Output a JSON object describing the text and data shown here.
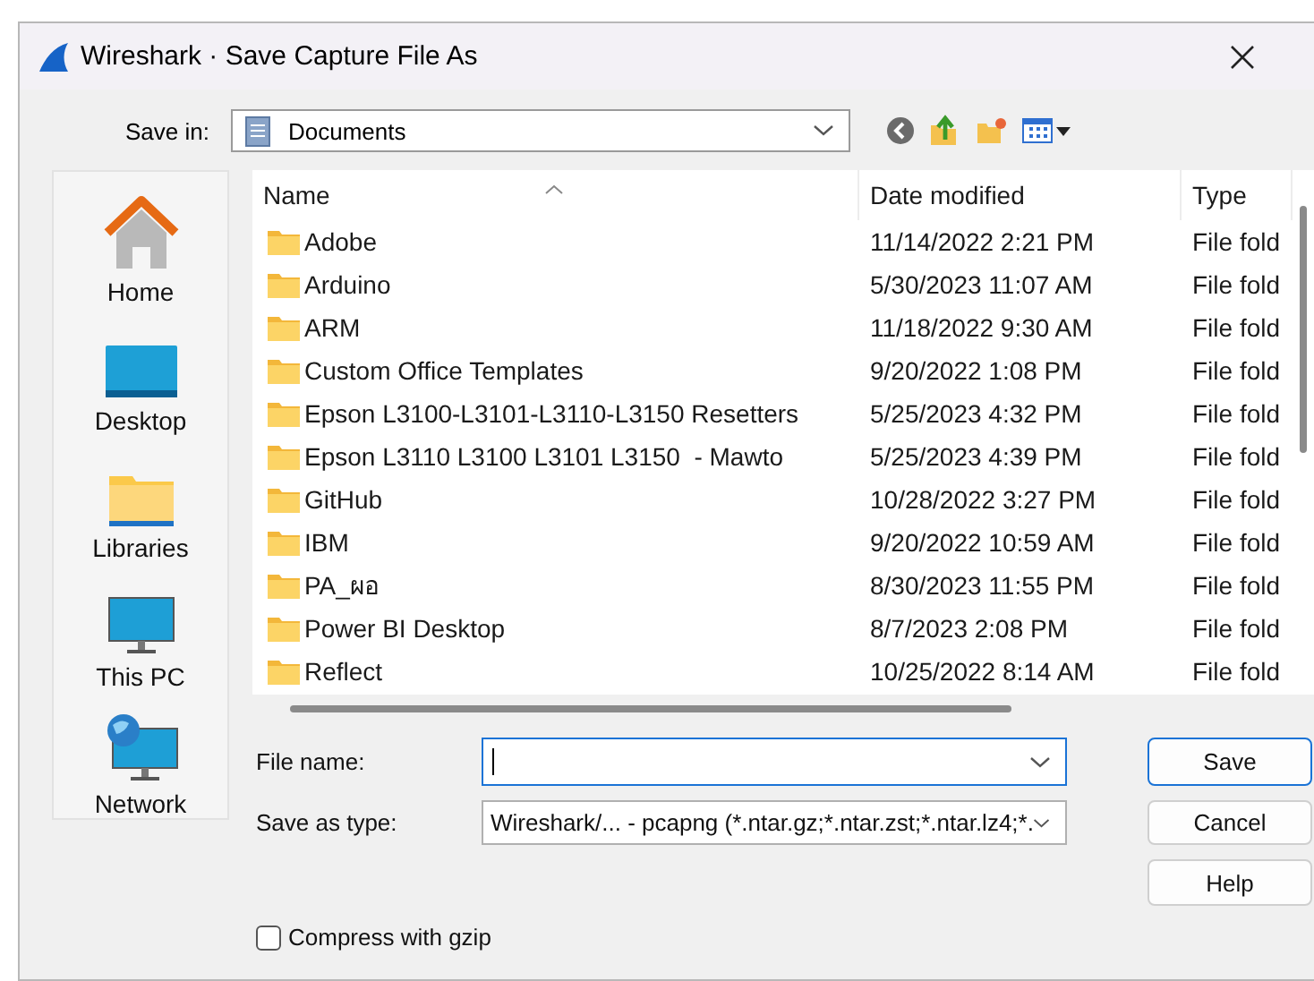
{
  "window": {
    "title": "Wireshark · Save Capture File As"
  },
  "save_in": {
    "label": "Save in:",
    "value": "Documents"
  },
  "places": [
    {
      "label": "Home",
      "kind": "home"
    },
    {
      "label": "Desktop",
      "kind": "desktop"
    },
    {
      "label": "Libraries",
      "kind": "libraries"
    },
    {
      "label": "This PC",
      "kind": "pc"
    },
    {
      "label": "Network",
      "kind": "network"
    }
  ],
  "file_list": {
    "columns": [
      "Name",
      "Date modified",
      "Type"
    ],
    "rows": [
      {
        "name": "Adobe",
        "date": "11/14/2022 2:21 PM",
        "type": "File fold"
      },
      {
        "name": "Arduino",
        "date": "5/30/2023 11:07 AM",
        "type": "File fold"
      },
      {
        "name": "ARM",
        "date": "11/18/2022 9:30 AM",
        "type": "File fold"
      },
      {
        "name": "Custom Office Templates",
        "date": "9/20/2022 1:08 PM",
        "type": "File fold"
      },
      {
        "name": "Epson L3100-L3101-L3110-L3150 Resetters",
        "date": "5/25/2023 4:32 PM",
        "type": "File fold"
      },
      {
        "name": "Epson L3110 L3100 L3101 L3150  - Mawto",
        "date": "5/25/2023 4:39 PM",
        "type": "File fold"
      },
      {
        "name": "GitHub",
        "date": "10/28/2022 3:27 PM",
        "type": "File fold"
      },
      {
        "name": "IBM",
        "date": "9/20/2022 10:59 AM",
        "type": "File fold"
      },
      {
        "name": "PA_ผอ",
        "date": "8/30/2023 11:55 PM",
        "type": "File fold"
      },
      {
        "name": "Power BI Desktop",
        "date": "8/7/2023 2:08 PM",
        "type": "File fold"
      },
      {
        "name": "Reflect",
        "date": "10/25/2022 8:14 AM",
        "type": "File fold"
      }
    ]
  },
  "file_name": {
    "label": "File name:",
    "focused": true
  },
  "save_as_type": {
    "label": "Save as type:",
    "value": "Wireshark/... - pcapng (*.ntar.gz;*.ntar.zst;*.ntar.lz4;*."
  },
  "buttons": [
    {
      "label": "Save",
      "default": true
    },
    {
      "label": "Cancel",
      "default": false
    },
    {
      "label": "Help",
      "default": false
    }
  ],
  "compress": {
    "label": "Compress with gzip",
    "checked": false
  }
}
